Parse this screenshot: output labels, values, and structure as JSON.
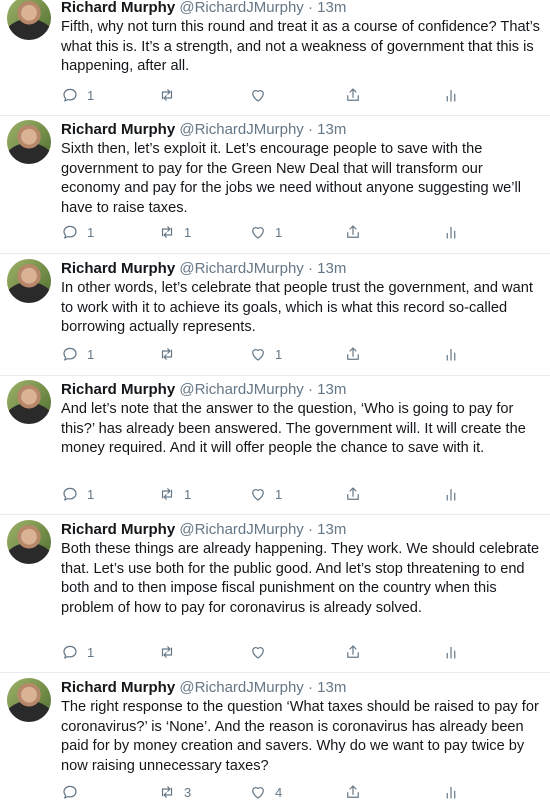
{
  "tweets": [
    {
      "name": "Richard Murphy",
      "handle": "@RichardJMurphy",
      "time": "· 13m",
      "text": "Fifth, why not turn this round and treat it as a course of confidence? That’s what this is. It’s a strength, and not a weakness of government that this is happening, after all.",
      "replies": "1",
      "retweets": "",
      "likes": ""
    },
    {
      "name": "Richard Murphy",
      "handle": "@RichardJMurphy",
      "time": "· 13m",
      "text": "Sixth then, let’s exploit it. Let’s encourage people to save with the government to pay for the Green New Deal that will transform our economy and pay for the jobs we need without anyone suggesting we’ll have to raise taxes.",
      "replies": "1",
      "retweets": "1",
      "likes": "1"
    },
    {
      "name": "Richard Murphy",
      "handle": "@RichardJMurphy",
      "time": "· 13m",
      "text": "In other words, let’s celebrate that people trust the government, and want to work with it to achieve its goals, which is what this record so-called borrowing actually represents.",
      "replies": "1",
      "retweets": "",
      "likes": "1"
    },
    {
      "name": "Richard Murphy",
      "handle": "@RichardJMurphy",
      "time": "· 13m",
      "text": "And let’s note that the answer to the question, ‘Who is going to pay for this?’ has already been answered. The government will. It will create the money required. And it will offer people the chance to save with it.",
      "replies": "1",
      "retweets": "1",
      "likes": "1"
    },
    {
      "name": "Richard Murphy",
      "handle": "@RichardJMurphy",
      "time": "· 13m",
      "text": "Both these things are already happening. They work. We should celebrate that. Let’s use both for the public good. And let’s stop threatening to end both and to then impose fiscal punishment on the country when this problem of how to pay for coronavirus is already solved.",
      "replies": "1",
      "retweets": "",
      "likes": ""
    },
    {
      "name": "Richard Murphy",
      "handle": "@RichardJMurphy",
      "time": "· 13m",
      "text": "The right response to the question ‘What taxes should be raised to pay for coronavirus?’ is ‘None’. And the reason is coronavirus has already been paid for by money creation and savers. Why do we want to pay twice by now raising unnecessary taxes?",
      "replies": "",
      "retweets": "3",
      "likes": "4"
    }
  ],
  "icons": {
    "reply": "reply-icon",
    "retweet": "retweet-icon",
    "like": "heart-icon",
    "share": "share-icon",
    "analytics": "analytics-icon"
  },
  "colors": {
    "text": "#14171a",
    "secondary": "#657786",
    "divider": "#e6ecf0"
  }
}
